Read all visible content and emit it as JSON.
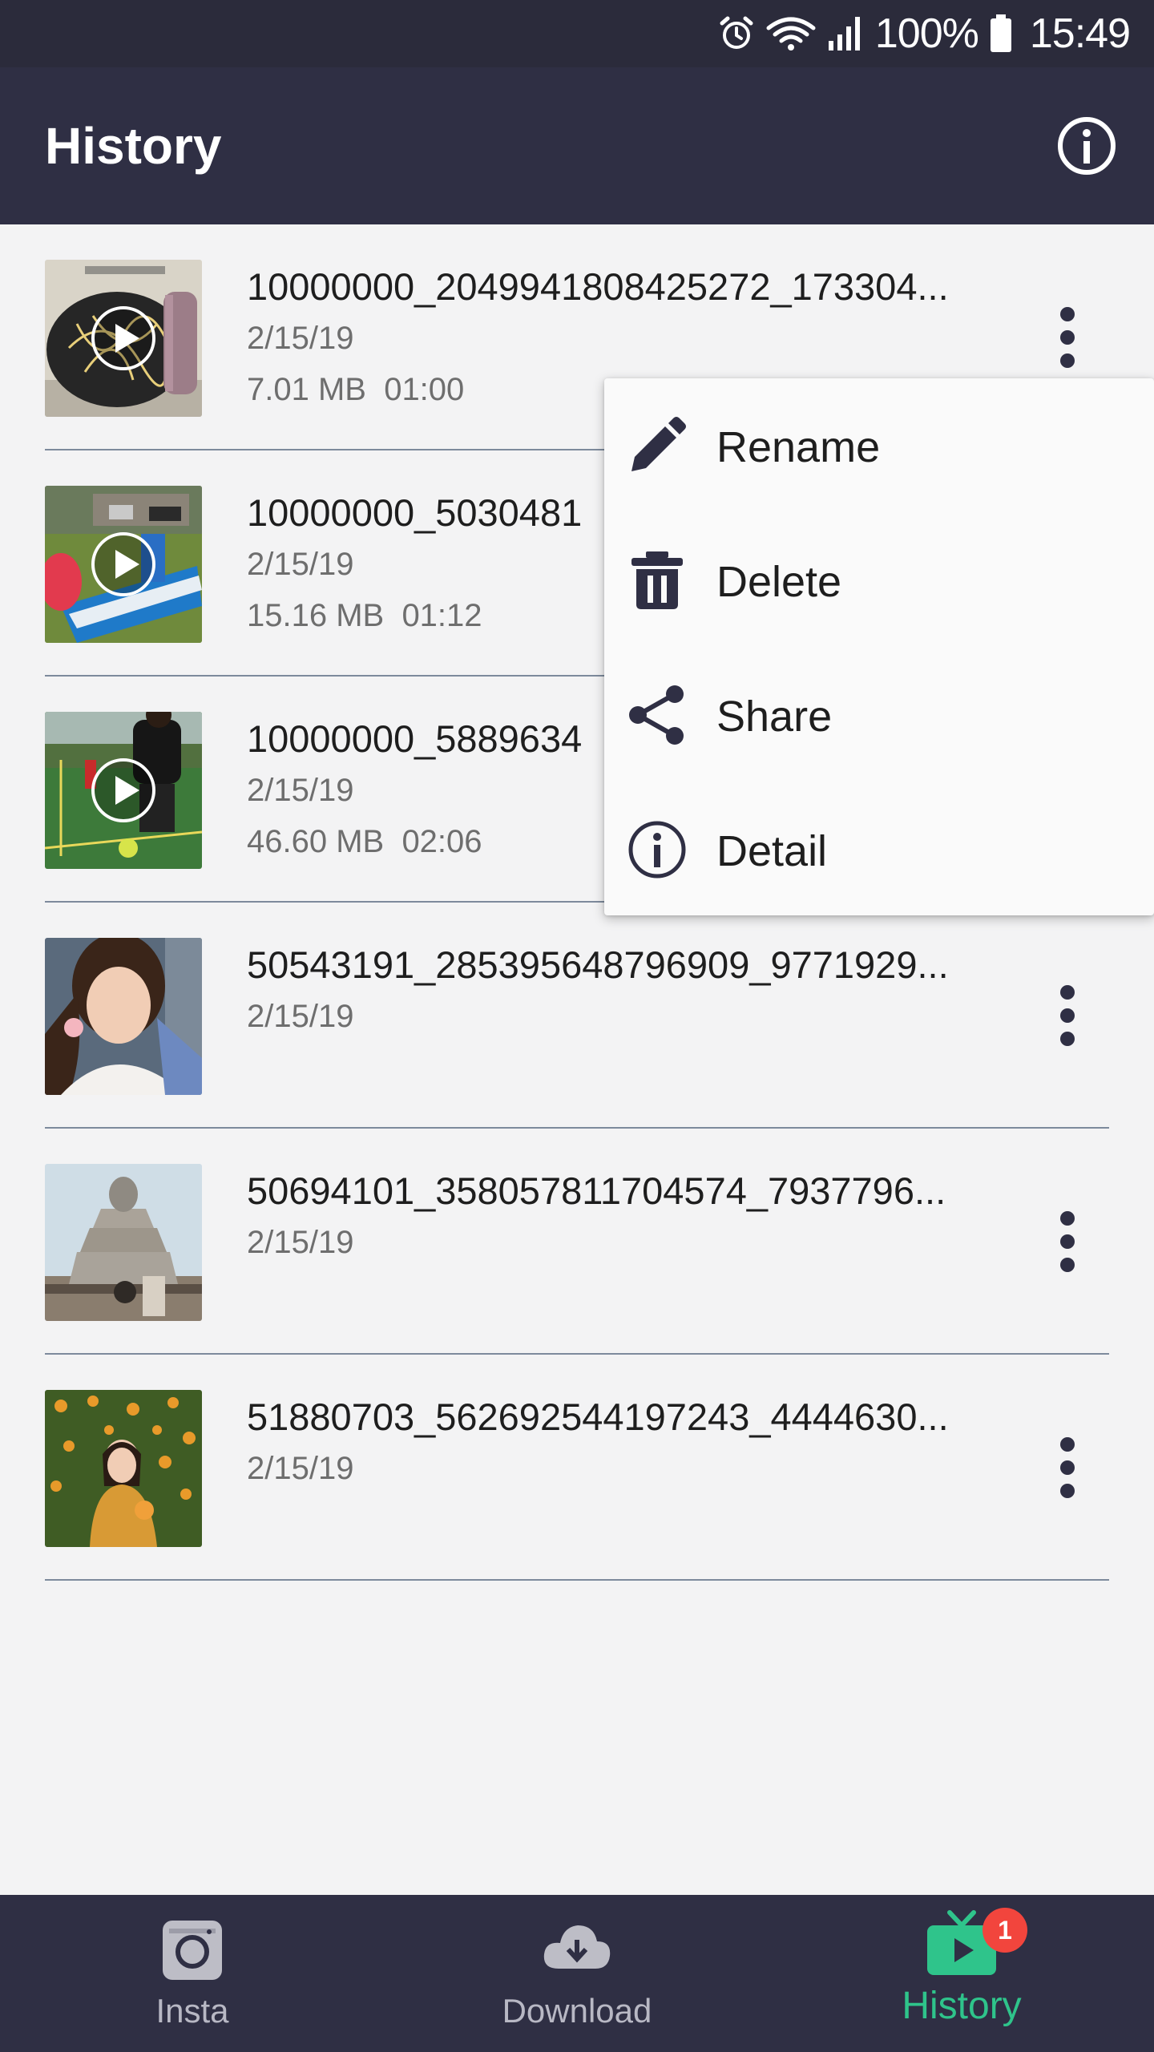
{
  "status_bar": {
    "icons": [
      "alarm-icon",
      "wifi-icon",
      "signal-icon",
      "battery-icon"
    ],
    "battery": "100%",
    "time": "15:49"
  },
  "app_bar": {
    "title": "History",
    "info_icon": "info-icon"
  },
  "items": [
    {
      "name": "10000000_2049941808425272_173304...",
      "date": "2/15/19",
      "meta": "7.01 MB  01:00",
      "is_video": true
    },
    {
      "name": "10000000_5030481",
      "date": "2/15/19",
      "meta": "15.16 MB  01:12",
      "is_video": true
    },
    {
      "name": "10000000_5889634",
      "date": "2/15/19",
      "meta": "46.60 MB  02:06",
      "is_video": true
    },
    {
      "name": "50543191_285395648796909_9771929...",
      "date": "2/15/19",
      "meta": "",
      "is_video": false
    },
    {
      "name": "50694101_358057811704574_7937796...",
      "date": "2/15/19",
      "meta": "",
      "is_video": false
    },
    {
      "name": "51880703_562692544197243_4444630...",
      "date": "2/15/19",
      "meta": "",
      "is_video": false
    }
  ],
  "popup_menu": {
    "items": [
      {
        "label": "Rename",
        "icon": "pencil-icon"
      },
      {
        "label": "Delete",
        "icon": "trash-icon"
      },
      {
        "label": "Share",
        "icon": "share-icon"
      },
      {
        "label": "Detail",
        "icon": "info-icon"
      }
    ]
  },
  "bottom_nav": {
    "tabs": [
      {
        "label": "Insta",
        "icon": "instagram-icon",
        "active": false
      },
      {
        "label": "Download",
        "icon": "cloud-download-icon",
        "active": false
      },
      {
        "label": "History",
        "icon": "tv-play-icon",
        "active": true
      }
    ],
    "badge": "1"
  },
  "colors": {
    "status_bar": "#2b2b3b",
    "app_bar": "#2f2f44",
    "background": "#f3f3f4",
    "accent": "#2fc48b",
    "badge": "#f2453d",
    "divider": "#7d8a9c"
  }
}
